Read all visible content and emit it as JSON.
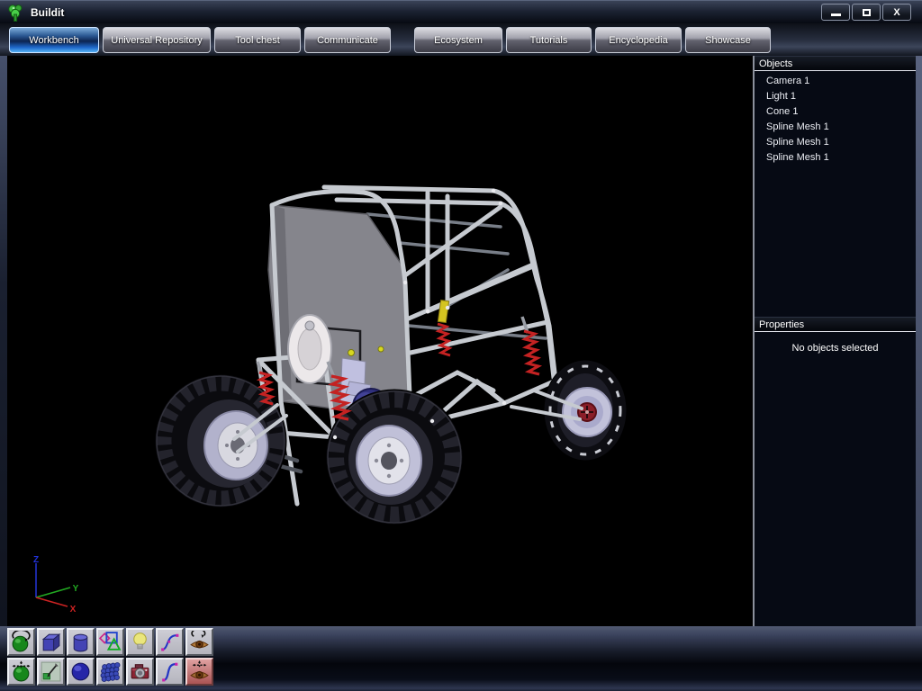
{
  "window": {
    "title": "Buildit",
    "controls": {
      "minimize": "minimize",
      "maximize": "maximize",
      "close": "X"
    }
  },
  "tabs": [
    {
      "label": "Workbench",
      "active": true
    },
    {
      "label": "Universal Repository",
      "active": false
    },
    {
      "label": "Tool chest",
      "active": false
    },
    {
      "label": "Communicate",
      "active": false
    },
    {
      "label": "Ecosystem",
      "active": false
    },
    {
      "label": "Tutorials",
      "active": false
    },
    {
      "label": "Encyclopedia",
      "active": false
    },
    {
      "label": "Showcase",
      "active": false
    }
  ],
  "viewport": {
    "content": "3D model of a tubular-frame off-road buggy with four knobby tires, red coil-over shocks and gray seat-back panel on black background",
    "axis": {
      "x": "X",
      "y": "Y",
      "z": "Z"
    }
  },
  "sidebar": {
    "objects_panel": {
      "title": "Objects",
      "items": [
        "Camera 1",
        "Light 1",
        "Cone 1",
        "Spline Mesh 1",
        "Spline Mesh 1",
        "Spline Mesh 1"
      ]
    },
    "properties_panel": {
      "title": "Properties",
      "empty_message": "No objects selected"
    }
  },
  "toolbar": {
    "rows": [
      {
        "buttons": [
          {
            "icon": "rotate-object-icon"
          },
          {
            "icon": "cube-primitive-icon"
          },
          {
            "icon": "cylinder-primitive-icon"
          },
          {
            "icon": "2d-shapes-icon"
          },
          {
            "icon": "light-icon"
          },
          {
            "icon": "spline-curve-icon"
          },
          {
            "icon": "rotate-view-eye-icon"
          }
        ]
      },
      {
        "buttons": [
          {
            "icon": "move-object-icon"
          },
          {
            "icon": "edit-tool-icon"
          },
          {
            "icon": "sphere-primitive-icon"
          },
          {
            "icon": "spline-mesh-icon"
          },
          {
            "icon": "camera-icon"
          },
          {
            "icon": "draw-spline-icon"
          },
          {
            "icon": "move-view-eye-icon",
            "active": true
          }
        ]
      }
    ]
  },
  "colors": {
    "active_tab_blue": "#2f8fe8",
    "inactive_tab_gray": "#8d8d97",
    "frame_silver": "#c6cad0",
    "panel_gray": "#87878d",
    "spring_red": "#cc2222",
    "active_tool_red": "#c27878",
    "axis_x": "#cc2222",
    "axis_y": "#22aa22",
    "axis_z": "#2233cc"
  }
}
